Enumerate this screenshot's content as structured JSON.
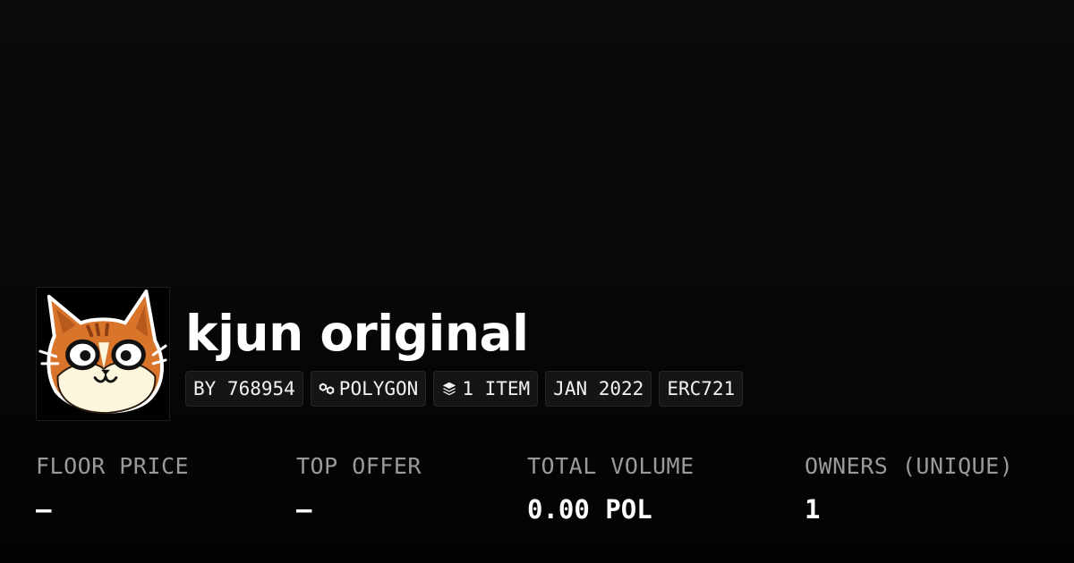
{
  "collection": {
    "title": "kjun original",
    "avatar_icon": "cat-face-icon"
  },
  "chips": {
    "creator": "BY 768954",
    "chain": "POLYGON",
    "chain_icon": "chain-link-icon",
    "items": "1 ITEM",
    "items_icon": "layers-icon",
    "date": "JAN 2022",
    "standard": "ERC721"
  },
  "stats": {
    "floor_price": {
      "label": "FLOOR PRICE",
      "value": "–"
    },
    "top_offer": {
      "label": "TOP OFFER",
      "value": "–"
    },
    "total_volume": {
      "label": "TOTAL VOLUME",
      "value": "0.00 POL"
    },
    "owners": {
      "label": "OWNERS (UNIQUE)",
      "value": "1"
    }
  },
  "colors": {
    "background": "#0a0a0a",
    "chip_background": "#151515",
    "label": "#9a9a9a",
    "text": "#ffffff",
    "cat_orange": "#d9742b",
    "cat_cream": "#fbf6dc"
  }
}
